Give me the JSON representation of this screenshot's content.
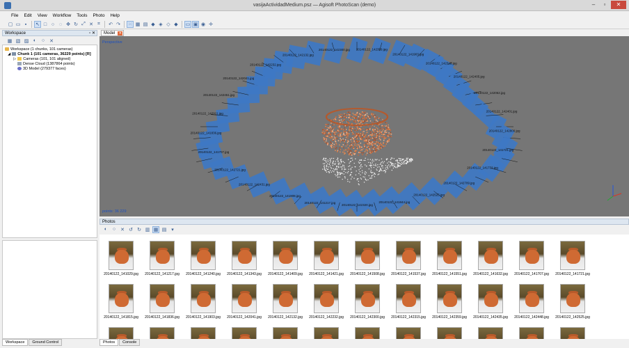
{
  "window": {
    "title": "vasijaActividadMedium.psz — Agisoft PhotoScan (demo)",
    "min": "–",
    "max": "▫",
    "close": "✕"
  },
  "menu": [
    "File",
    "Edit",
    "View",
    "Workflow",
    "Tools",
    "Photo",
    "Help"
  ],
  "toolbar_icons": [
    "new-icon",
    "open-icon",
    "save-icon",
    "select-icon",
    "rect-select-icon",
    "circle-select-icon",
    "free-select-icon",
    "move-icon",
    "rotate-icon",
    "resize-icon",
    "delete-icon",
    "crop-icon",
    "undo-icon",
    "redo-icon",
    "point-cloud-icon",
    "dense-cloud-icon",
    "mesh-icon",
    "shaded-icon",
    "solid-icon",
    "wireframe-icon",
    "textured-icon",
    "show-cameras-icon",
    "show-region-icon",
    "show-trackball-icon",
    "reset-view-icon"
  ],
  "workspace": {
    "header": "Workspace",
    "tree": {
      "root": "Workspace (1 chunks, 101 cameras)",
      "chunk": "Chunk 1 (101 cameras, 36229 points) [R]",
      "cameras": "Cameras (101, 101 aligned)",
      "dense_cloud": "Dense Cloud (1387864 points)",
      "model": "3D Model (279377 faces)"
    },
    "tabs": [
      "Workspace",
      "Ground Control"
    ]
  },
  "model_tab": {
    "label": "Model"
  },
  "viewport": {
    "projection": "Perspective",
    "points": "points: 36 229",
    "labels": [
      "20140122_141721.jpg",
      "20140122_141732.jpg",
      "20140122_142709.jpg",
      "20140122_142525.jpg",
      "20140122_141844.jpg",
      "20140122_142320.jpg",
      "20140122_141217.jpg",
      "20140122_141908.jpg",
      "20140122_142431.jpg",
      "20140122_142721.jpg",
      "20140122_141707.jpg",
      "20140122_141836.jpg",
      "20140122_142911.jpg",
      "20140122_142451.jpg",
      "20140122_142041.jpg",
      "20140122_142232.jpg",
      "20140122_142132.jpg",
      "20140122_142300.jpg",
      "20140122_142359.jpg",
      "20140122_141903.jpg",
      "20140122_142345.jpg",
      "20140122_142405.jpg",
      "20140122_142052.jpg",
      "20140122_142401.jpg",
      "20140122_142800.jpg"
    ]
  },
  "photos": {
    "header": "Photos",
    "tabs": [
      "Photos",
      "Console"
    ],
    "items": [
      "20140122_141029.jpg",
      "20140122_141217.jpg",
      "20140122_141240.jpg",
      "20140122_141343.jpg",
      "20140122_141409.jpg",
      "20140122_141421.jpg",
      "20140122_141508.jpg",
      "20140122_141537.jpg",
      "20140122_141551.jpg",
      "20140122_141632.jpg",
      "20140122_141707.jpg",
      "20140122_141721.jpg",
      "20140122_141815.jpg",
      "20140122_141836.jpg",
      "20140122_141903.jpg",
      "20140122_142041.jpg",
      "20140122_142132.jpg",
      "20140122_142232.jpg",
      "20140122_142300.jpg",
      "20140122_142315.jpg",
      "20140122_142359.jpg",
      "20140122_142435.jpg",
      "20140122_142448.jpg",
      "20140122_142525.jpg"
    ]
  },
  "colors": {
    "camera_plane": "#3e78c4",
    "background": "#767676",
    "pot": "#cf6a33",
    "accent": "#1a4fc0"
  }
}
